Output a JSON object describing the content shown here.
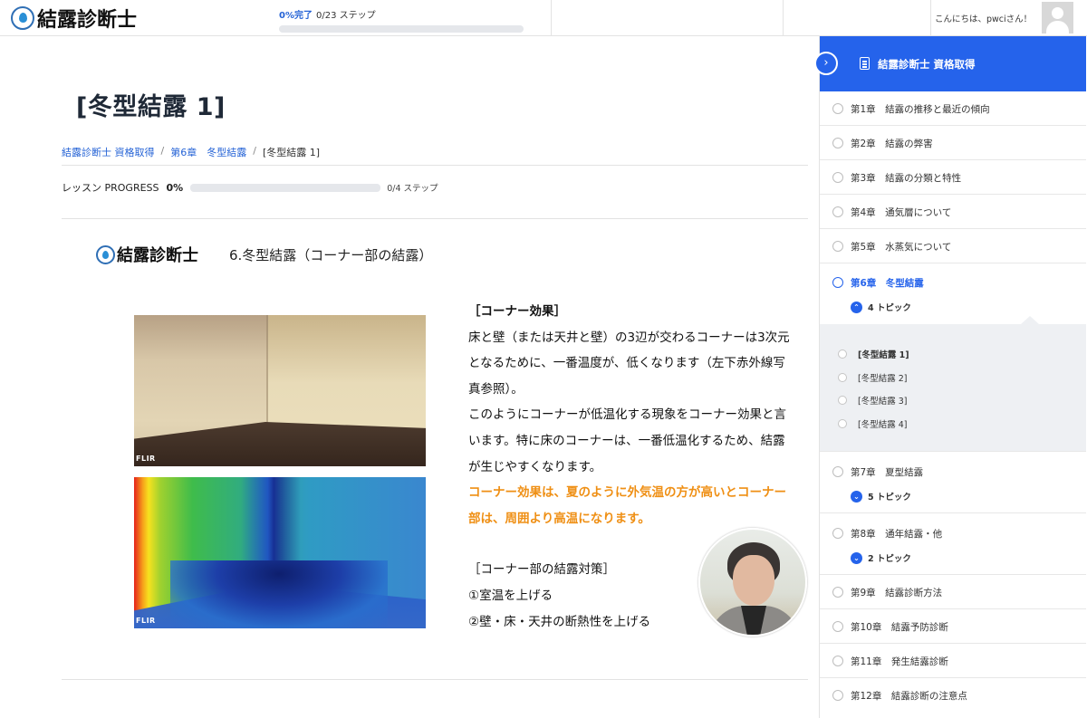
{
  "header": {
    "logo_text": "結露診断士",
    "progress_pct": "0%完了",
    "progress_steps": "0/23 ステップ",
    "progress_fraction": 0,
    "greeting": "こんにちは、pwciさん！"
  },
  "main": {
    "title": "[冬型結露 1]",
    "breadcrumb": [
      "結露診断士 資格取得",
      "第6章　冬型結露",
      "[冬型結露 1]"
    ],
    "lesson_progress_label": "レッスン PROGRESS",
    "lesson_progress_pct": "0%",
    "lesson_progress_fraction": 0,
    "lesson_progress_steps": "0/4 ステップ"
  },
  "slide": {
    "logo_text": "結露診断士",
    "title": "6.冬型結露（コーナー部の結露）",
    "flir_label": "FLIR",
    "heading1": "［コーナー効果］",
    "para1": "床と壁（または天井と壁）の3辺が交わるコーナーは3次元となるために、一番温度が、低くなります（左下赤外線写真参照）。",
    "para2": "このようにコーナーが低温化する現象をコーナー効果と言います。特に床のコーナーは、一番低温化するため、結露が生じやすくなります。",
    "highlight": "コーナー効果は、夏のように外気温の方が高いとコーナー部は、周囲より高温になります。",
    "heading2": "［コーナー部の結露対策］",
    "item1": "①室温を上げる",
    "item2": "②壁・床・天井の断熱性を上げる"
  },
  "sidebar": {
    "course_title": "結露診断士 資格取得",
    "chapters": [
      {
        "label": "第1章　結露の推移と最近の傾向"
      },
      {
        "label": "第2章　結露の弊害"
      },
      {
        "label": "第3章　結露の分類と特性"
      },
      {
        "label": "第4章　通気層について"
      },
      {
        "label": "第5章　水蒸気について"
      },
      {
        "label": "第6章　冬型結露",
        "topics": "4 トピック"
      },
      {
        "label": "第7章　夏型結露",
        "topics": "5 トピック"
      },
      {
        "label": "第8章　通年結露・他",
        "topics": "2 トピック"
      },
      {
        "label": "第9章　結露診断方法"
      },
      {
        "label": "第10章　結露予防診断"
      },
      {
        "label": "第11章　発生結露診断"
      },
      {
        "label": "第12章　結露診断の注意点"
      }
    ],
    "topics": [
      "[冬型結露 1]",
      "[冬型結露 2]",
      "[冬型結露 3]",
      "[冬型結露 4]"
    ]
  },
  "colors": {
    "accent": "#2563eb",
    "highlight_text": "#ef8f14"
  }
}
